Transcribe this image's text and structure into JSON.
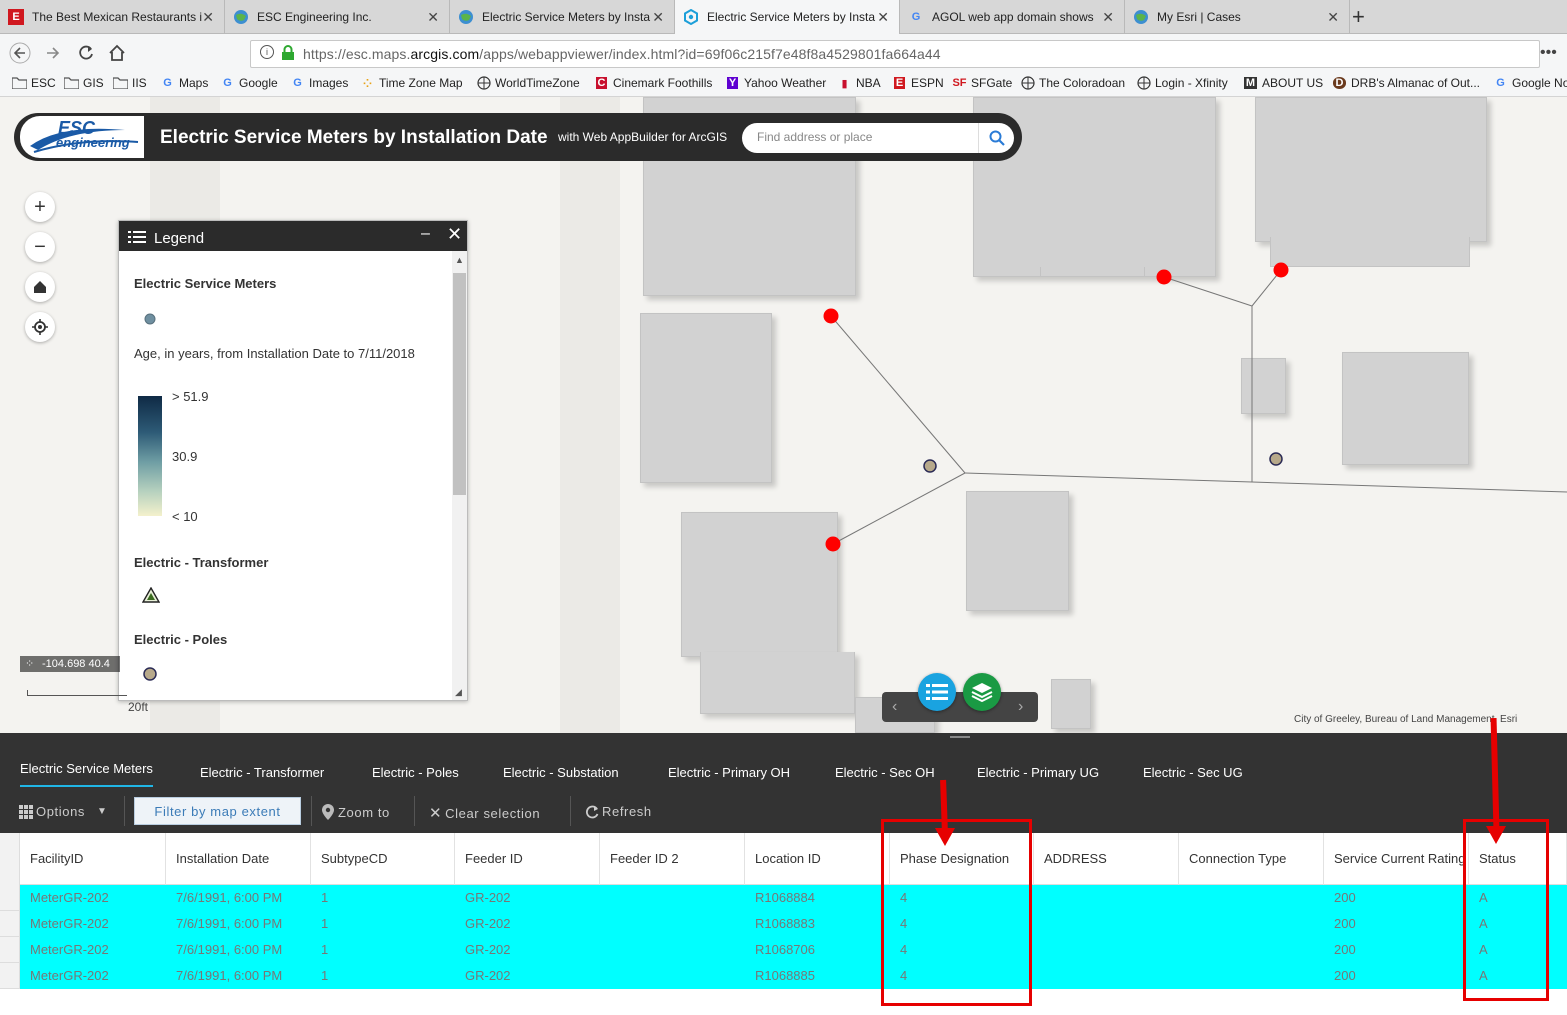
{
  "browser": {
    "tabs": [
      {
        "title": "The Best Mexican Restaurants i",
        "icon": "E",
        "active": false
      },
      {
        "title": "ESC Engineering Inc.",
        "icon": "globe",
        "active": false
      },
      {
        "title": "Electric Service Meters by Insta",
        "icon": "globe",
        "active": false
      },
      {
        "title": "Electric Service Meters by Insta",
        "icon": "webapp",
        "active": true
      },
      {
        "title": "AGOL web app domain shows",
        "icon": "G",
        "active": false
      },
      {
        "title": "My Esri | Cases",
        "icon": "globe",
        "active": false
      }
    ],
    "url_prefix": "https://esc.maps.",
    "url_domain": "arcgis.com",
    "url_path": "/apps/webappviewer/index.html?id=69f06c215f7e48f8a4529801fa664a44",
    "bookmarks": [
      {
        "label": "ESC",
        "icon": "folder"
      },
      {
        "label": "GIS",
        "icon": "folder"
      },
      {
        "label": "IIS",
        "icon": "folder"
      },
      {
        "label": "Maps",
        "icon": "G"
      },
      {
        "label": "Google",
        "icon": "G"
      },
      {
        "label": "Images",
        "icon": "G"
      },
      {
        "label": "Time Zone Map",
        "icon": "dots"
      },
      {
        "label": "WorldTimeZone",
        "icon": "globe"
      },
      {
        "label": "Cinemark Foothills",
        "icon": "C"
      },
      {
        "label": "Yahoo Weather",
        "icon": "Y"
      },
      {
        "label": "NBA",
        "icon": "nba"
      },
      {
        "label": "ESPN",
        "icon": "E"
      },
      {
        "label": "SFGate",
        "icon": "SF"
      },
      {
        "label": "The Coloradoan",
        "icon": "globe"
      },
      {
        "label": "Login - Xfinity",
        "icon": "globe"
      },
      {
        "label": "ABOUT US",
        "icon": "M"
      },
      {
        "label": "DRB's Almanac of Out...",
        "icon": "D"
      },
      {
        "label": "Google No",
        "icon": "G"
      }
    ]
  },
  "app": {
    "logo_line1": "ESC",
    "logo_line2": "engineering",
    "title": "Electric Service Meters by Installation Date",
    "subtitle": "with Web AppBuilder for ArcGIS",
    "search_placeholder": "Find address or place"
  },
  "legend": {
    "title": "Legend",
    "layer1": "Electric Service Meters",
    "age_label": "Age, in years, from Installation Date to 7/11/2018",
    "ramp_high": "> 51.9",
    "ramp_mid": "30.9",
    "ramp_low": "< 10",
    "layer2": "Electric - Transformer",
    "layer3": "Electric - Poles"
  },
  "map": {
    "coordinates": "-104.698 40.4",
    "scale": "20ft",
    "attribution": "City of Greeley, Bureau of Land Management, Esri"
  },
  "table": {
    "tabs": [
      "Electric Service Meters",
      "Electric - Transformer",
      "Electric - Poles",
      "Electric - Substation",
      "Electric - Primary OH",
      "Electric - Sec OH",
      "Electric - Primary UG",
      "Electric - Sec UG"
    ],
    "tools": {
      "options": "Options",
      "filter": "Filter by map extent",
      "zoom": "Zoom to",
      "clear": "Clear selection",
      "refresh": "Refresh"
    },
    "columns": [
      "FacilityID",
      "Installation Date",
      "SubtypeCD",
      "Feeder ID",
      "Feeder ID 2",
      "Location ID",
      "Phase Designation",
      "ADDRESS",
      "Connection Type",
      "Service Current Rating",
      "Status"
    ],
    "rows": [
      [
        "MeterGR-202",
        "7/6/1991, 6:00 PM",
        "1",
        "GR-202",
        "",
        "R1068884",
        "4",
        "",
        "",
        "200",
        "A"
      ],
      [
        "MeterGR-202",
        "7/6/1991, 6:00 PM",
        "1",
        "GR-202",
        "",
        "R1068883",
        "4",
        "",
        "",
        "200",
        "A"
      ],
      [
        "MeterGR-202",
        "7/6/1991, 6:00 PM",
        "1",
        "GR-202",
        "",
        "R1068706",
        "4",
        "",
        "",
        "200",
        "A"
      ],
      [
        "MeterGR-202",
        "7/6/1991, 6:00 PM",
        "1",
        "GR-202",
        "",
        "R1068885",
        "4",
        "",
        "",
        "200",
        "A"
      ]
    ]
  },
  "colors": {
    "meter_new": "#ff0000",
    "meter_old": "#b7a98b",
    "selection": "#00ffff",
    "annotation": "#e60000"
  }
}
